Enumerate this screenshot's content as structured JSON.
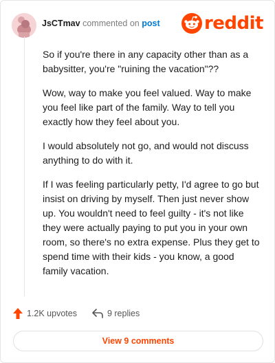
{
  "header": {
    "username": "JsCTmav",
    "action_text": "commented on",
    "post_link": "post",
    "logo_text": "reddit",
    "brand_color": "#ff4500"
  },
  "comment": {
    "paragraphs": [
      "So if you're there in any capacity other than as a babysitter, you're \"ruining the vacation\"??",
      "Wow, way to make you feel valued. Way to make you feel like part of the family. Way to tell you exactly how they feel about you.",
      "I would absolutely not go, and would not discuss anything to do with it.",
      "If I was feeling particularly petty, I'd agree to go but insist on driving by myself. Then just never show up. You wouldn't need to feel guilty - it's not like they were actually paying to put you in your own room, so there's no extra expense. Plus they get to spend time with their kids - you know, a good family vacation."
    ]
  },
  "actions": {
    "upvotes": "1.2K upvotes",
    "replies": "9 replies",
    "upvote_icon": "upvote-arrow-icon",
    "reply_icon": "reply-arrow-icon"
  },
  "footer": {
    "view_comments": "View 9 comments"
  }
}
